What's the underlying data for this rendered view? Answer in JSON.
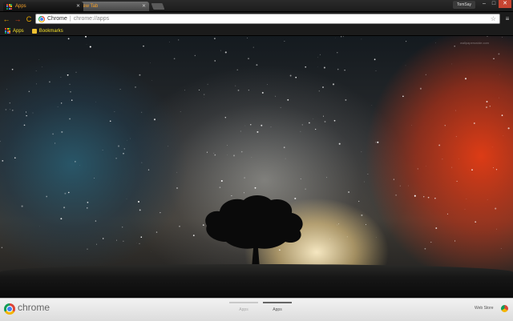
{
  "tabs": [
    {
      "label": "Apps",
      "active": true
    },
    {
      "label": "New Tab",
      "active": false
    }
  ],
  "profile": {
    "name": "TomSay"
  },
  "window_controls": {
    "minimize": "–",
    "maximize": "□",
    "close": "✕"
  },
  "toolbar": {
    "back": "←",
    "forward": "→",
    "reload": "C",
    "menu": "≡"
  },
  "omnibox": {
    "site_label": "Chrome",
    "separator": "|",
    "url": "chrome://apps",
    "star": "☆"
  },
  "bookmarks": [
    {
      "label": "Apps",
      "icon": "apps-grid-icon"
    },
    {
      "label": "Bookmarks",
      "icon": "folder-icon"
    }
  ],
  "wallpaper": {
    "watermark": "wallpaperswide.com"
  },
  "shelf": {
    "brand": "chrome",
    "pages": [
      {
        "label": "Apps",
        "selected": false
      },
      {
        "label": "Apps",
        "selected": true
      }
    ],
    "webstore_label": "Web Store"
  },
  "colors": {
    "accent_orange": "#f6a12a",
    "bookmark_yellow": "#f6e12a",
    "close_red": "#c64532"
  }
}
